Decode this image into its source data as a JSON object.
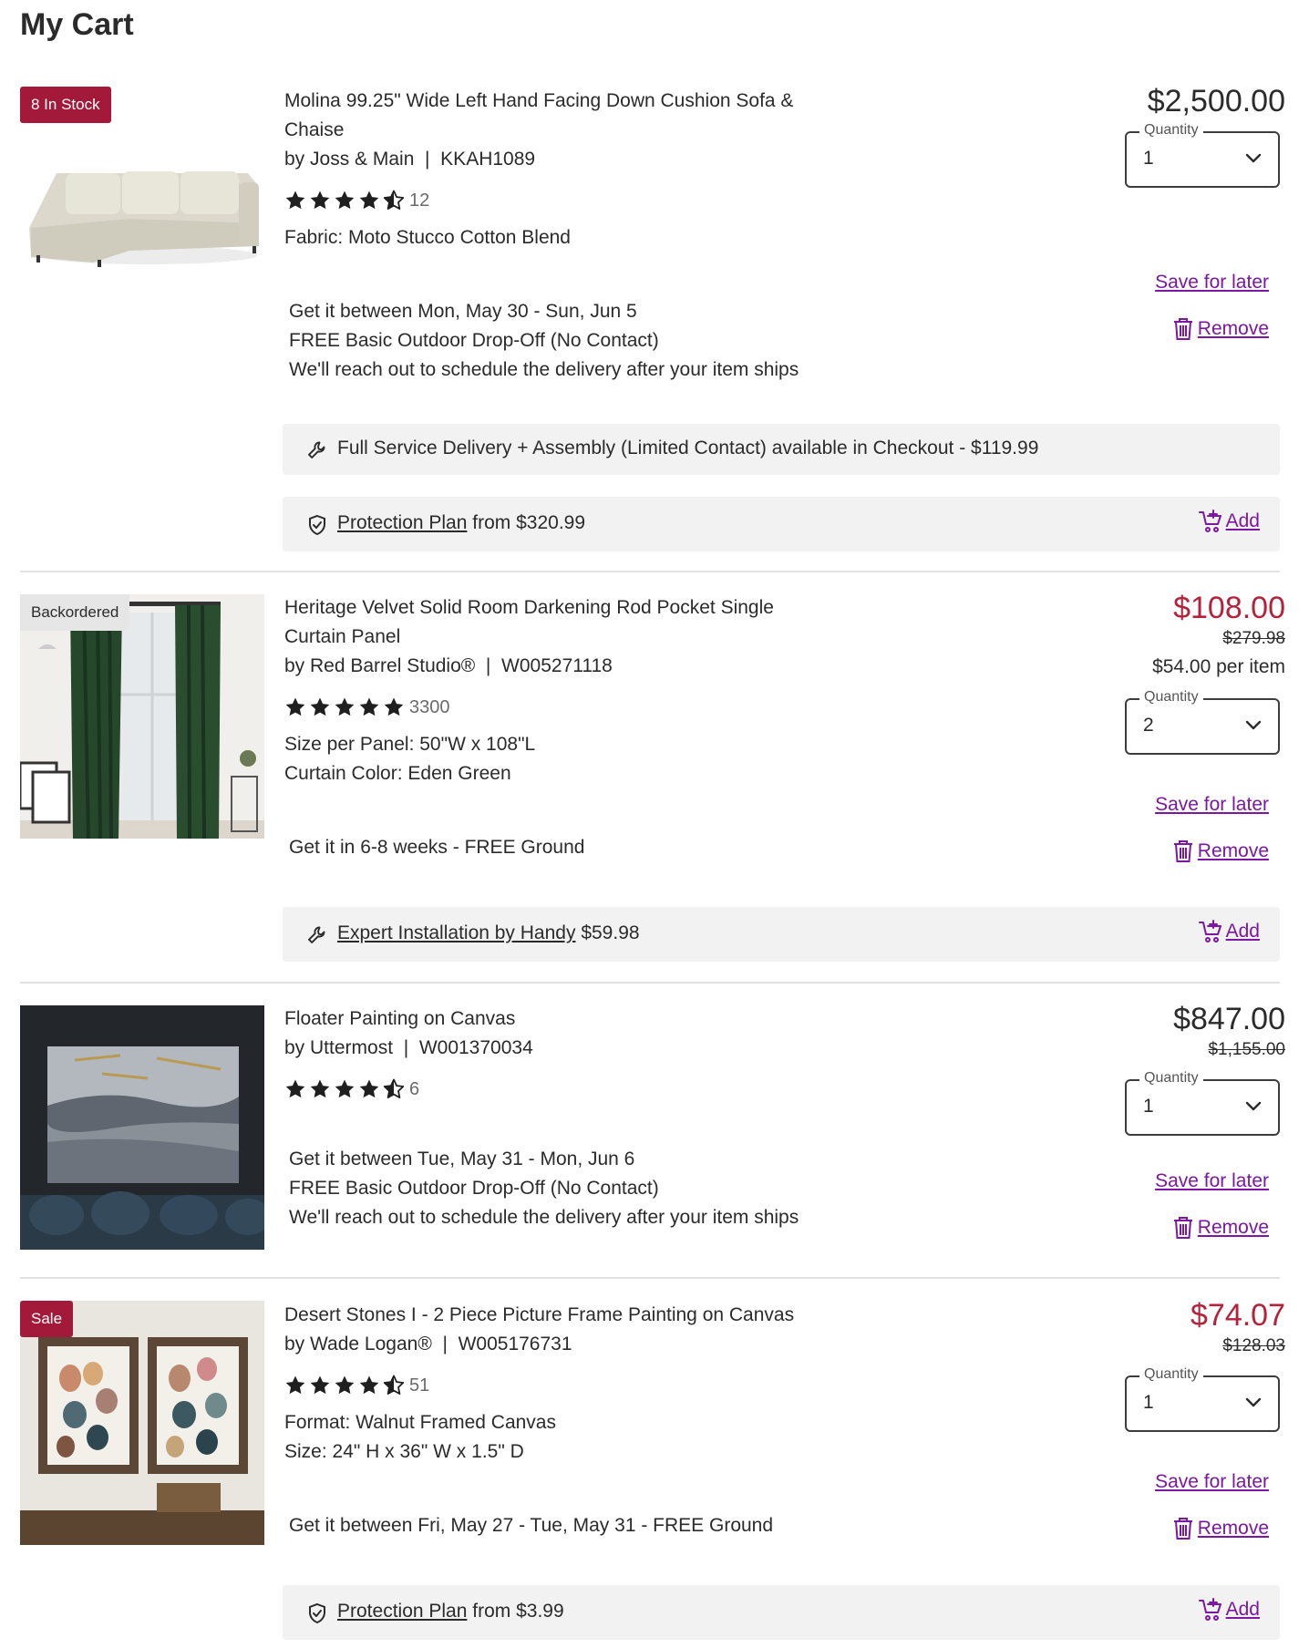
{
  "page": {
    "title": "My Cart"
  },
  "labels": {
    "quantity": "Quantity",
    "save_for_later": "Save for later",
    "remove": "Remove",
    "add": "Add"
  },
  "colors": {
    "accent": "#7b189f",
    "sale": "#b5223c",
    "badge_red": "#a3193a",
    "banner_bg": "#f2f2f2"
  },
  "items": [
    {
      "badge": "8 In Stock",
      "name_line1": "Molina 99.25\" Wide Left Hand Facing Down Cushion Sofa &",
      "name_line2": "Chaise",
      "brand_sku": "by Joss & Main  |  KKAH1089",
      "rating": 4.5,
      "review_count": "12",
      "option1": "Fabric: Moto Stucco Cotton Blend",
      "ship_line1": "Get it between Mon, May 30 - Sun, Jun 5",
      "ship_line2": "FREE Basic Outdoor Drop-Off (No Contact)",
      "ship_line3": "We'll reach out to schedule the delivery after your item ships",
      "price": "$2,500.00",
      "quantity": "1",
      "service_banner": "Full Service Delivery + Assembly (Limited Contact) available in Checkout - $119.99",
      "protection_link": "Protection Plan",
      "protection_price": "from $320.99"
    },
    {
      "badge": "Backordered",
      "name_line1": "Heritage Velvet Solid Room Darkening Rod Pocket Single",
      "name_line2": "Curtain Panel",
      "brand_sku": "by Red Barrel Studio®  |  W005271118",
      "rating": 5,
      "review_count": "3300",
      "option1": "Size per Panel: 50\"W x 108\"L",
      "option2": "Curtain Color: Eden Green",
      "ship_line1": "Get it in 6-8 weeks - FREE Ground",
      "price": "$108.00",
      "original_price": "$279.98",
      "per_item": "$54.00 per item",
      "quantity": "2",
      "install_link": "Expert Installation by Handy",
      "install_price": "$59.98"
    },
    {
      "name_line1": "Floater Painting on Canvas",
      "brand_sku": "by Uttermost  |  W001370034",
      "rating": 4.5,
      "review_count": "6",
      "ship_line1": "Get it between Tue, May 31 - Mon, Jun 6",
      "ship_line2": "FREE Basic Outdoor Drop-Off (No Contact)",
      "ship_line3": "We'll reach out to schedule the delivery after your item ships",
      "price": "$847.00",
      "original_price": "$1,155.00",
      "quantity": "1"
    },
    {
      "badge": "Sale",
      "name_line1": "Desert Stones I - 2 Piece Picture Frame Painting on Canvas",
      "brand_sku": "by Wade Logan®  |  W005176731",
      "rating": 4.5,
      "review_count": "51",
      "option1": "Format: Walnut Framed Canvas",
      "option2": "Size: 24\" H x 36\" W x 1.5\" D",
      "ship_line1": "Get it between Fri, May 27 - Tue, May 31 - FREE Ground",
      "price": "$74.07",
      "original_price": "$128.03",
      "quantity": "1",
      "protection_link": "Protection Plan",
      "protection_price": "from $3.99"
    }
  ]
}
